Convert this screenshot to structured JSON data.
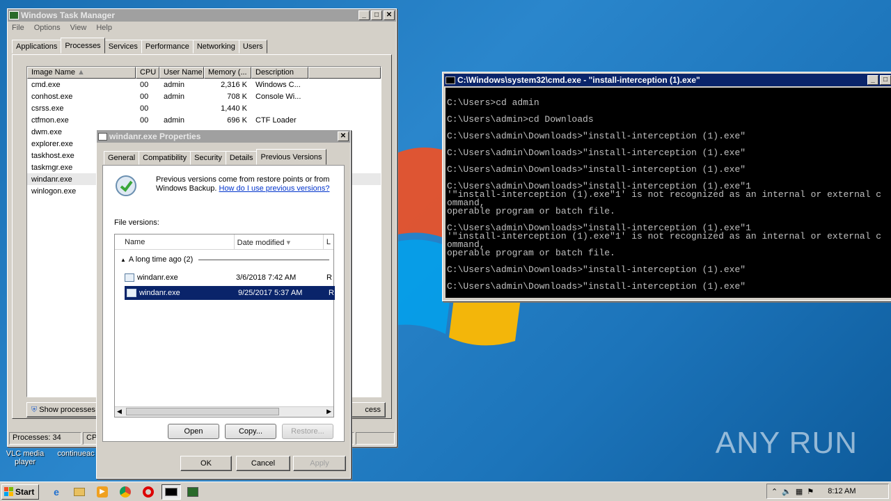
{
  "desktop": {
    "icons": [
      {
        "label": "VLC media player"
      },
      {
        "label": "continueac"
      }
    ],
    "watermark": "ANY RUN"
  },
  "taskmgr": {
    "title": "Windows Task Manager",
    "menu": [
      "File",
      "Options",
      "View",
      "Help"
    ],
    "tabs": [
      "Applications",
      "Processes",
      "Services",
      "Performance",
      "Networking",
      "Users"
    ],
    "columns": [
      "Image Name",
      "CPU",
      "User Name",
      "Memory (...",
      "Description"
    ],
    "rows": [
      {
        "name": "cmd.exe",
        "cpu": "00",
        "user": "admin",
        "mem": "2,316 K",
        "desc": "Windows C..."
      },
      {
        "name": "conhost.exe",
        "cpu": "00",
        "user": "admin",
        "mem": "708 K",
        "desc": "Console Wi..."
      },
      {
        "name": "csrss.exe",
        "cpu": "00",
        "user": "",
        "mem": "1,440 K",
        "desc": ""
      },
      {
        "name": "ctfmon.exe",
        "cpu": "00",
        "user": "admin",
        "mem": "696 K",
        "desc": "CTF Loader"
      },
      {
        "name": "dwm.exe",
        "cpu": "",
        "user": "",
        "mem": "",
        "desc": ""
      },
      {
        "name": "explorer.exe",
        "cpu": "",
        "user": "",
        "mem": "",
        "desc": ""
      },
      {
        "name": "taskhost.exe",
        "cpu": "",
        "user": "",
        "mem": "",
        "desc": ""
      },
      {
        "name": "taskmgr.exe",
        "cpu": "",
        "user": "",
        "mem": "",
        "desc": ""
      },
      {
        "name": "windanr.exe",
        "cpu": "",
        "user": "",
        "mem": "",
        "desc": ""
      },
      {
        "name": "winlogon.exe",
        "cpu": "",
        "user": "",
        "mem": "",
        "desc": ""
      }
    ],
    "show_processes_label": "Show processes",
    "end_process_label": "cess",
    "status_processes": "Processes: 34",
    "status_cpu": "CPU"
  },
  "props": {
    "title": "windanr.exe Properties",
    "tabs": [
      "General",
      "Compatibility",
      "Security",
      "Details",
      "Previous Versions"
    ],
    "intro_text": "Previous versions come from restore points or from Windows Backup.",
    "intro_link": "How do I use previous versions?",
    "file_versions_label": "File versions:",
    "columns": [
      "Name",
      "Date modified",
      "L"
    ],
    "group_label": "A long time ago (2)",
    "versions": [
      {
        "name": "windanr.exe",
        "date": "3/6/2018 7:42 AM",
        "loc": "R"
      },
      {
        "name": "windanr.exe",
        "date": "9/25/2017 5:37 AM",
        "loc": "R"
      }
    ],
    "buttons": {
      "open": "Open",
      "copy": "Copy...",
      "restore": "Restore..."
    },
    "dialog_buttons": {
      "ok": "OK",
      "cancel": "Cancel",
      "apply": "Apply"
    }
  },
  "cmd": {
    "title": "C:\\Windows\\system32\\cmd.exe - \"install-interception (1).exe\"",
    "lines": [
      "",
      "C:\\Users>cd admin",
      "",
      "C:\\Users\\admin>cd Downloads",
      "",
      "C:\\Users\\admin\\Downloads>\"install-interception (1).exe\"",
      "",
      "C:\\Users\\admin\\Downloads>\"install-interception (1).exe\"",
      "",
      "C:\\Users\\admin\\Downloads>\"install-interception (1).exe\"",
      "",
      "C:\\Users\\admin\\Downloads>\"install-interception (1).exe\"1",
      "'\"install-interception (1).exe\"1' is not recognized as an internal or external c",
      "ommand,",
      "operable program or batch file.",
      "",
      "C:\\Users\\admin\\Downloads>\"install-interception (1).exe\"1",
      "'\"install-interception (1).exe\"1' is not recognized as an internal or external c",
      "ommand,",
      "operable program or batch file.",
      "",
      "C:\\Users\\admin\\Downloads>\"install-interception (1).exe\"",
      "",
      "C:\\Users\\admin\\Downloads>\"install-interception (1).exe\"",
      "",
      "_"
    ]
  },
  "taskbar": {
    "start_label": "Start",
    "icons": [
      "ie-icon",
      "folder-icon",
      "media-player-icon",
      "chrome-icon",
      "opera-icon",
      "cmd-icon",
      "taskmgr-icon"
    ],
    "clock": "8:12 AM"
  }
}
